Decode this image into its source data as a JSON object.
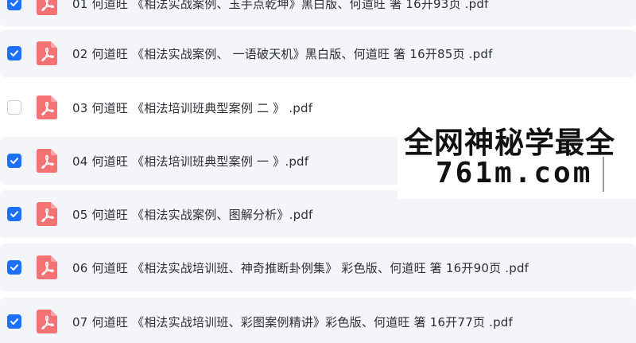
{
  "files": [
    {
      "name": "01 何道旺 《相法实战案例、玉手点乾坤》黑白版、何道旺 箸 16开93页 .pdf",
      "checked": true
    },
    {
      "name": "02 何道旺 《相法实战案例、 一语破天机》黑白版、何道旺 箸 16开85页 .pdf",
      "checked": true
    },
    {
      "name": "03 何道旺 《相法培训班典型案例 二 》 .pdf",
      "checked": false
    },
    {
      "name": "04 何道旺 《相法培训班典型案例 一 》.pdf",
      "checked": true
    },
    {
      "name": "05 何道旺 《相法实战案例、图解分析》.pdf",
      "checked": true
    },
    {
      "name": "06 何道旺 《相法实战培训班、神奇推断卦例集》 彩色版、何道旺 箸 16开90页 .pdf",
      "checked": true
    },
    {
      "name": "07 何道旺 《相法实战培训班、彩图案例精讲》彩色版、何道旺 箸 16开77页 .pdf",
      "checked": true
    }
  ],
  "icons": {
    "checkbox_checked": "checkbox-checked-icon",
    "checkbox_unchecked": "checkbox-unchecked-icon",
    "file_type": "pdf-file-icon"
  },
  "watermark": {
    "line1": "全网神秘学最全",
    "line2": "761m.com"
  },
  "colors": {
    "accent": "#1e6fff",
    "pdf_icon": "#f47174",
    "row_selected_bg": "#f3f5f8",
    "text": "#2b2f36"
  }
}
